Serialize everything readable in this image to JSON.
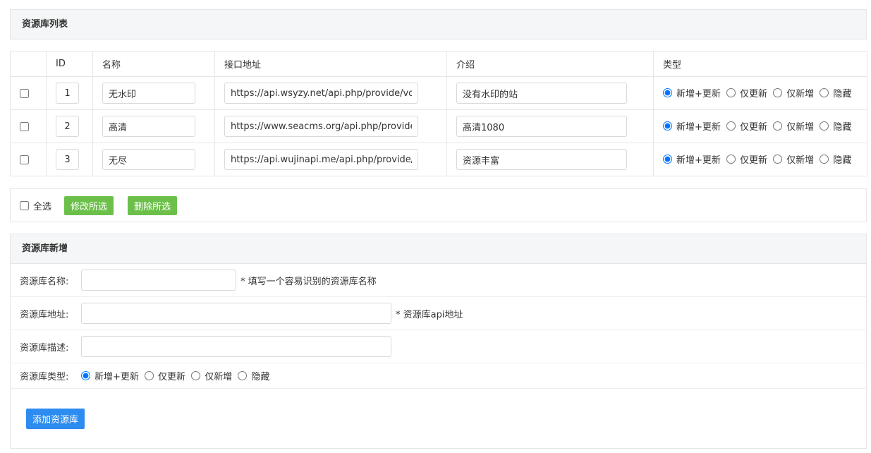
{
  "list_panel": {
    "title": "资源库列表"
  },
  "table": {
    "headers": {
      "id": "ID",
      "name": "名称",
      "url": "接口地址",
      "desc": "介绍",
      "type": "类型"
    },
    "rows": [
      {
        "id": "1",
        "name": "无水印",
        "url": "https://api.wsyzy.net/api.php/provide/vod/",
        "desc": "没有水印的站",
        "selected_type": "新增+更新"
      },
      {
        "id": "2",
        "name": "高清",
        "url": "https://www.seacms.org/api.php/provide/vod/",
        "desc": "高清1080",
        "selected_type": "新增+更新"
      },
      {
        "id": "3",
        "name": "无尽",
        "url": "https://api.wujinapi.me/api.php/provide/vod/",
        "desc": "资源丰富",
        "selected_type": "新增+更新"
      }
    ],
    "type_options": [
      "新增+更新",
      "仅更新",
      "仅新增",
      "隐藏"
    ]
  },
  "actions": {
    "select_all": "全选",
    "edit_selected": "修改所选",
    "delete_selected": "删除所选"
  },
  "add_panel": {
    "title": "资源库新增",
    "name_label": "资源库名称:",
    "name_hint": "* 填写一个容易识别的资源库名称",
    "url_label": "资源库地址:",
    "url_hint": "* 资源库api地址",
    "desc_label": "资源库描述:",
    "type_label": "资源库类型:",
    "type_options": [
      "新增+更新",
      "仅更新",
      "仅新增",
      "隐藏"
    ],
    "selected_type": "新增+更新",
    "submit": "添加资源库"
  },
  "colors": {
    "green_button": "#6cc04a",
    "blue_button": "#2d8cf0",
    "header_bg": "#f5f6f7",
    "border": "#e6e6e6"
  }
}
